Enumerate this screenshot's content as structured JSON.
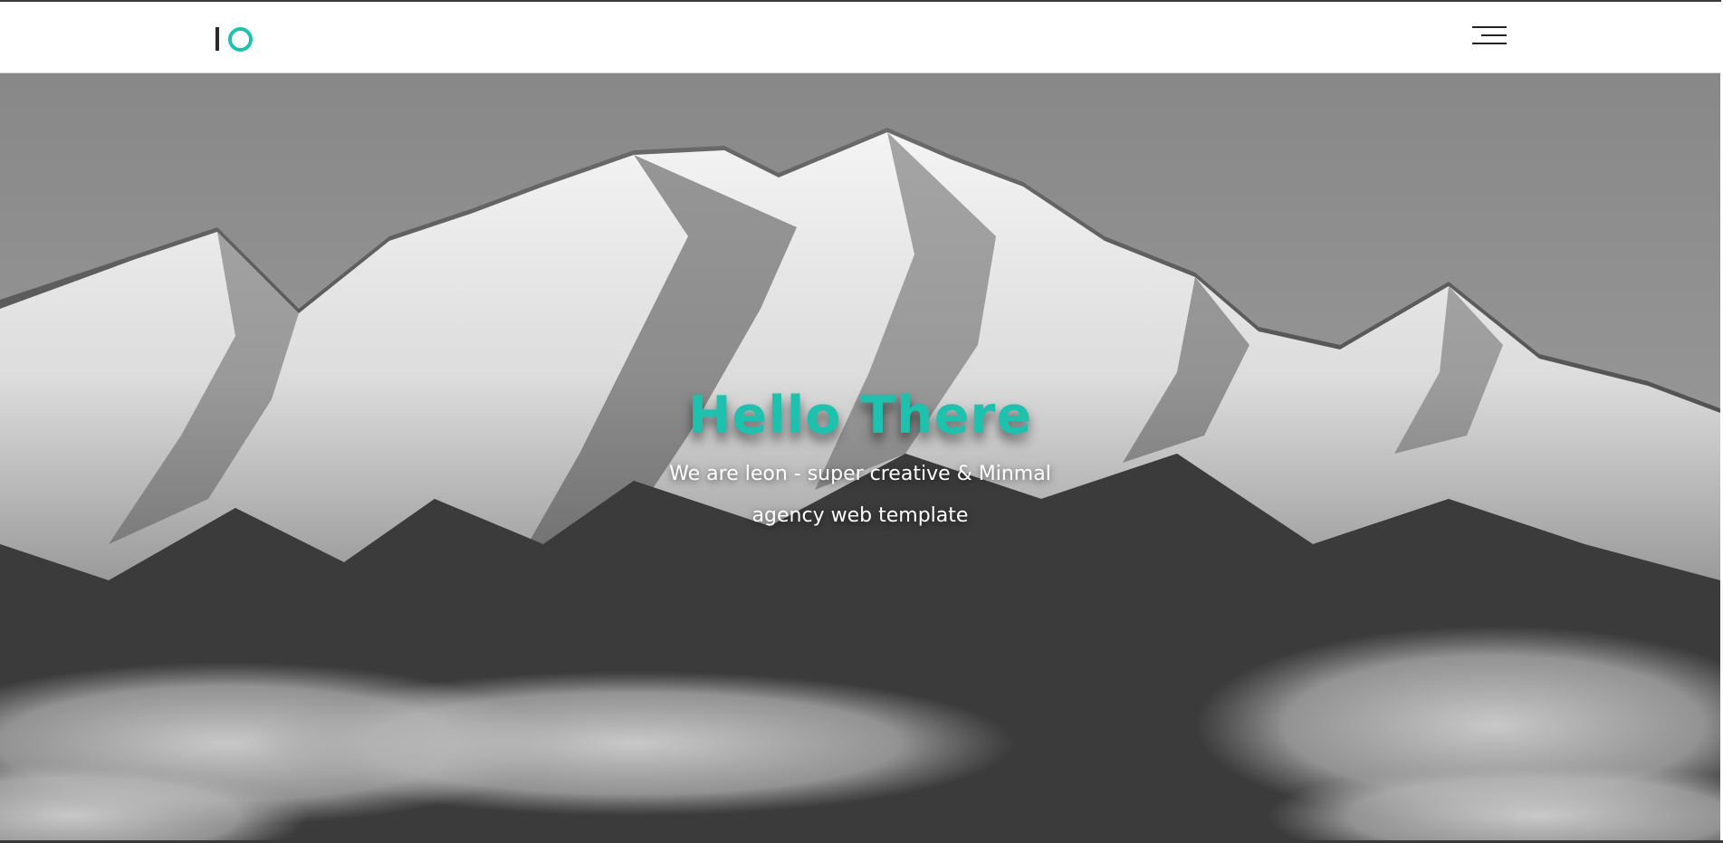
{
  "header": {
    "logo_label": "lO",
    "menu_icon": "hamburger-menu-icon"
  },
  "hero": {
    "title": "Hello There",
    "subtitle": "We are leon - super creative & Minmal agency web template",
    "background": "snow-mountain-photo-grayscale"
  },
  "colors": {
    "accent": "#1ec1ae",
    "text_light": "#ffffff",
    "dark": "#222222"
  }
}
